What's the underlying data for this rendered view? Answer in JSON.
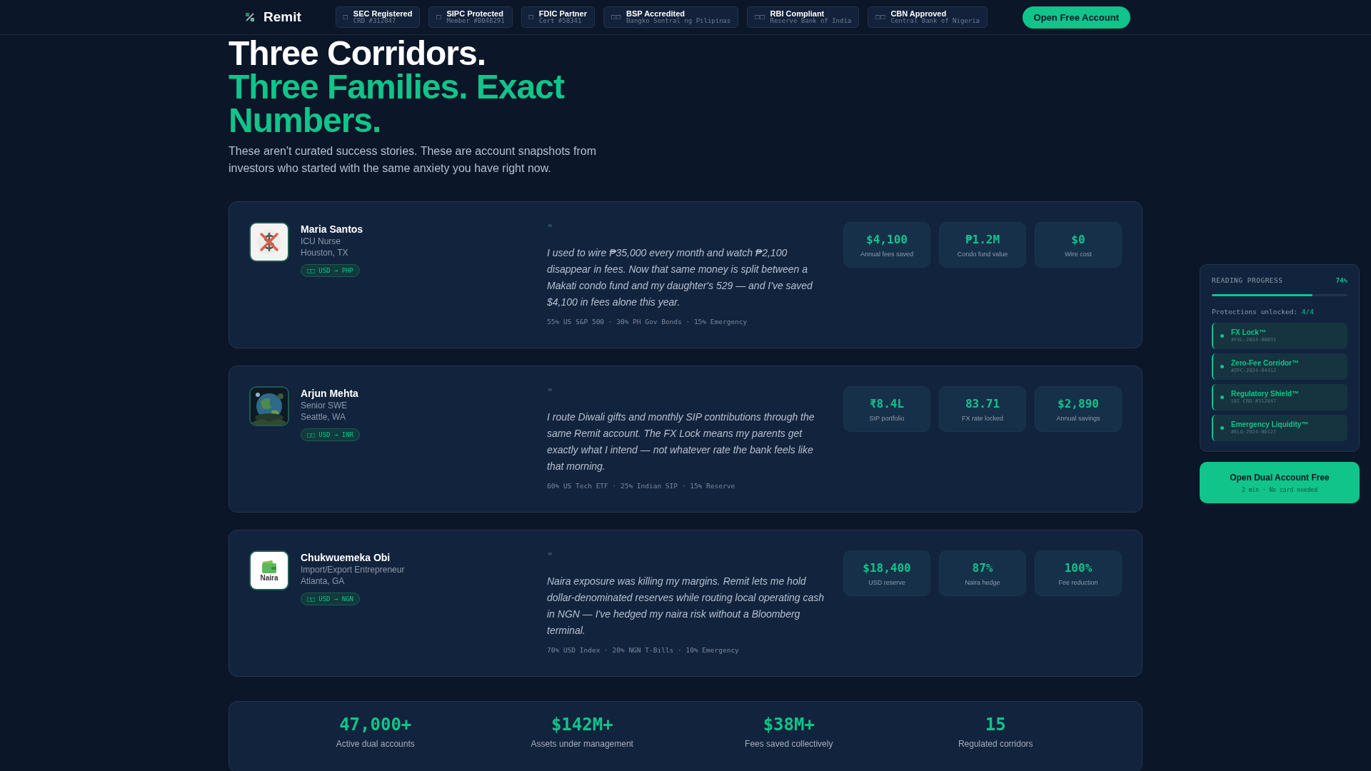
{
  "header": {
    "brand": "Remit",
    "badges": [
      {
        "icon": "□",
        "title": "SEC Registered",
        "sub": "CRD #312847"
      },
      {
        "icon": "□",
        "title": "SIPC Protected",
        "sub": "Member #0048291"
      },
      {
        "icon": "□",
        "title": "FDIC Partner",
        "sub": "Cert #58341"
      },
      {
        "icon": "□□",
        "title": "BSP Accredited",
        "sub": "Bangko Sentral ng Pilipinas"
      },
      {
        "icon": "□□",
        "title": "RBI Compliant",
        "sub": "Reserve Bank of India"
      },
      {
        "icon": "□□",
        "title": "CBN Approved",
        "sub": "Central Bank of Nigeria"
      }
    ],
    "cta": "Open Free Account"
  },
  "hero": {
    "title_lines": [
      "Three Corridors."
    ],
    "accent_lines": [
      "Three Families. Exact",
      "Numbers."
    ],
    "lead": "These aren't curated success stories. These are account snapshots from investors who started with the same anxiety you have right now."
  },
  "stories": [
    {
      "avatar": {
        "kind": "no-dollar"
      },
      "name": "Maria Santos",
      "role": "ICU Nurse",
      "city": "Houston, TX",
      "corridor": "□□ USD → PHP",
      "quote_mark": "\"",
      "quote": "I used to wire ₱35,000 every month and watch ₱2,100 disappear in fees. Now that same money is split between a Makati condo fund and my daughter's 529 — and I've saved $4,100 in fees alone this year.",
      "allocation": "55% US S&P 500 · 30% PH Gov Bonds · 15% Emergency",
      "metrics": [
        {
          "value": "$4,100",
          "label": "Annual fees saved"
        },
        {
          "value": "₱1.2M",
          "label": "Condo fund value"
        },
        {
          "value": "$0",
          "label": "Wire cost"
        }
      ]
    },
    {
      "avatar": {
        "kind": "picture"
      },
      "name": "Arjun Mehta",
      "role": "Senior SWE",
      "city": "Seattle, WA",
      "corridor": "□□ USD → INR",
      "quote_mark": "\"",
      "quote": "I route Diwali gifts and monthly SIP contributions through the same Remit account. The FX Lock means my parents get exactly what I intend — not whatever rate the bank feels like that morning.",
      "allocation": "60% US Tech ETF · 25% Indian SIP · 15% Reserve",
      "metrics": [
        {
          "value": "₹8.4L",
          "label": "SIP portfolio"
        },
        {
          "value": "83.71",
          "label": "FX rate locked"
        },
        {
          "value": "$2,890",
          "label": "Annual savings"
        }
      ]
    },
    {
      "avatar": {
        "kind": "wallet",
        "caption": "Naira"
      },
      "name": "Chukwuemeka Obi",
      "role": "Import/Export Entrepreneur",
      "city": "Atlanta, GA",
      "corridor": "□□ USD → NGN",
      "quote_mark": "\"",
      "quote": "Naira exposure was killing my margins. Remit lets me hold dollar-denominated reserves while routing local operating cash in NGN — I've hedged my naira risk without a Bloomberg terminal.",
      "allocation": "70% USD Index · 20% NGN T-Bills · 10% Emergency",
      "metrics": [
        {
          "value": "$18,400",
          "label": "USD reserve"
        },
        {
          "value": "87%",
          "label": "Naira hedge"
        },
        {
          "value": "100%",
          "label": "Fee reduction"
        }
      ]
    }
  ],
  "stats": [
    {
      "value": "47,000+",
      "label": "Active dual accounts"
    },
    {
      "value": "$142M+",
      "label": "Assets under management"
    },
    {
      "value": "$38M+",
      "label": "Fees saved collectively"
    },
    {
      "value": "15",
      "label": "Regulated corridors"
    }
  ],
  "progress": {
    "title": "READING PROGRESS",
    "reading": "74%",
    "level": 0.74,
    "unlocked_label": "Protections unlocked:",
    "unlocked_count": "4/4",
    "items": [
      {
        "name": "FX Lock™",
        "code": "#FXL-2024-00891",
        "unlocked": true
      },
      {
        "name": "Zero-Fee Corridor™",
        "code": "#ZFC-2024-04412",
        "unlocked": true
      },
      {
        "name": "Regulatory Shield™",
        "code": "SEC CRD #312847",
        "unlocked": true
      },
      {
        "name": "Emergency Liquidity™",
        "code": "#ELQ-2024-00127",
        "unlocked": true
      }
    ],
    "cta": "Open Dual Account Free",
    "cta_sub": "2 min · No card needed"
  }
}
